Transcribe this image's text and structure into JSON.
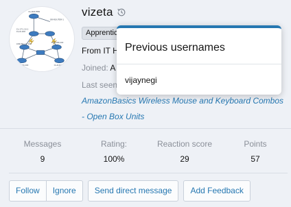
{
  "profile": {
    "username": "vizeta",
    "badge": "Apprentic",
    "from_label": "From IT H",
    "joined_label": "Joined:",
    "joined_value": "A",
    "last_seen_label": "Last seen",
    "activity": "AmazonBasics Wireless Mouse and Keyboard Combos - Open Box Units"
  },
  "avatar_labels": [
    "CL-ROUTER",
    "OR-ROUTER-1",
    "CL-171.10.1",
    "CL-R-100",
    "ASR-NA-17.100",
    "CL-HUB-100",
    "N-VPN-100",
    "CL-R-NA-1A"
  ],
  "stats": [
    {
      "label": "Messages",
      "value": "9"
    },
    {
      "label": "Rating:",
      "value": "100%"
    },
    {
      "label": "Reaction score",
      "value": "29"
    },
    {
      "label": "Points",
      "value": "57"
    }
  ],
  "actions": {
    "follow": "Follow",
    "ignore": "Ignore",
    "send_message": "Send direct message",
    "add_feedback": "Add Feedback"
  },
  "popup": {
    "title": "Previous usernames",
    "items": [
      "vijaynegi"
    ]
  },
  "colors": {
    "accent": "#2577b1",
    "muted": "#8a8f98",
    "background": "#eef1f6"
  },
  "icons": {
    "history": "history-icon"
  }
}
